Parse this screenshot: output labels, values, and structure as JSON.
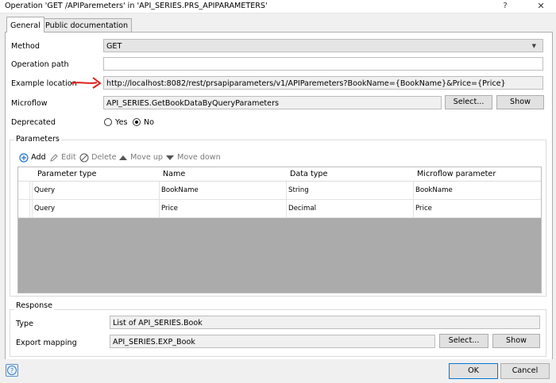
{
  "window": {
    "title": "Operation 'GET /APIParemeters' in 'API_SERIES.PRS_APIPARAMETERS'",
    "help_glyph": "?",
    "close_glyph": "✕"
  },
  "tabs": [
    {
      "label": "General",
      "active": true
    },
    {
      "label": "Public documentation",
      "active": false
    }
  ],
  "form": {
    "method_label": "Method",
    "method_value": "GET",
    "operation_path_label": "Operation path",
    "operation_path_value": "",
    "example_location_label": "Example location",
    "example_location_value": "http://localhost:8082/rest/prsapiparameters/v1/APIParemeters?BookName={BookName}&Price={Price}",
    "microflow_label": "Microflow",
    "microflow_value": "API_SERIES.GetBookDataByQueryParameters",
    "select_label": "Select...",
    "show_label": "Show",
    "deprecated_label": "Deprecated",
    "deprecated_yes": "Yes",
    "deprecated_no": "No",
    "deprecated_selected": "No"
  },
  "parameters": {
    "group_title": "Parameters",
    "toolbar": {
      "add": "Add",
      "edit": "Edit",
      "delete": "Delete",
      "move_up": "Move up",
      "move_down": "Move down"
    },
    "columns": [
      "Parameter type",
      "Name",
      "Data type",
      "Microflow parameter"
    ],
    "rows": [
      [
        "Query",
        "BookName",
        "String",
        "BookName"
      ],
      [
        "Query",
        "Price",
        "Decimal",
        "Price"
      ]
    ]
  },
  "response": {
    "group_title": "Response",
    "type_label": "Type",
    "type_value": "List of API_SERIES.Book",
    "export_mapping_label": "Export mapping",
    "export_mapping_value": "API_SERIES.EXP_Book",
    "select_label": "Select...",
    "show_label": "Show"
  },
  "footer": {
    "ok_label": "OK",
    "cancel_label": "Cancel"
  },
  "colors": {
    "annotation_arrow": "#e0201b",
    "primary_border": "#0078d7"
  }
}
